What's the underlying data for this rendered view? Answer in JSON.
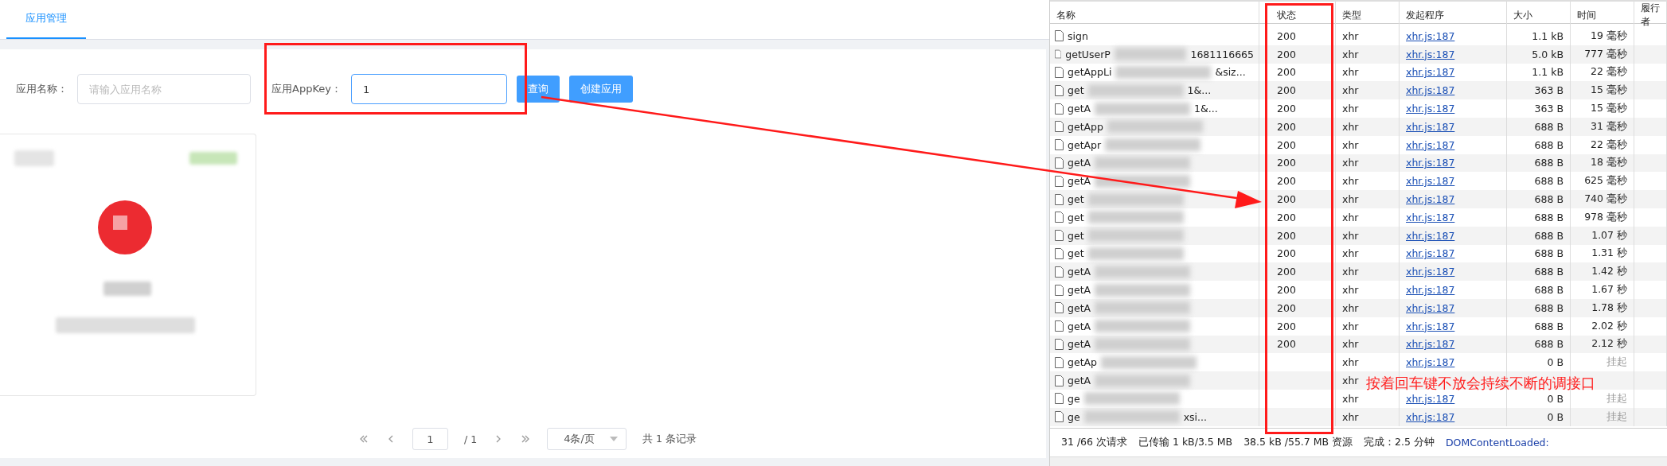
{
  "tabs": [
    {
      "label": "应用管理",
      "selected": true
    }
  ],
  "search_form": {
    "fields": [
      {
        "label": "应用名称：",
        "placeholder": "请输入应用名称"
      },
      {
        "label": "应用AppKey：",
        "value": "1"
      }
    ],
    "buttons": [
      "查询",
      "创建应用"
    ]
  },
  "pagination": {
    "page": "1",
    "total_pages": "/ 1",
    "page_size": "4条/页",
    "total": "共 1 条记录"
  },
  "network": {
    "columns": [
      "名称",
      "状态",
      "类型",
      "发起程序",
      "大小",
      "时间",
      "履行者"
    ],
    "rows": [
      {
        "name": "sign",
        "status": "200",
        "type": "xhr",
        "initiator": "xhr.js:187",
        "size": "1.1 kB",
        "time": "19 毫秒",
        "pending": false
      },
      {
        "name": "getUserP",
        "name_end": "1681116665",
        "status": "200",
        "type": "xhr",
        "initiator": "xhr.js:187",
        "size": "5.0 kB",
        "time": "777 毫秒",
        "pending": false
      },
      {
        "name": "getAppLi",
        "name_end": "&siz...",
        "status": "200",
        "type": "xhr",
        "initiator": "xhr.js:187",
        "size": "1.1 kB",
        "time": "22 毫秒",
        "pending": false
      },
      {
        "name": "get",
        "name_end": "1&...",
        "status": "200",
        "type": "xhr",
        "initiator": "xhr.js:187",
        "size": "363 B",
        "time": "15 毫秒",
        "pending": false
      },
      {
        "name": "getA",
        "name_end": "1&...",
        "status": "200",
        "type": "xhr",
        "initiator": "xhr.js:187",
        "size": "363 B",
        "time": "15 毫秒",
        "pending": false
      },
      {
        "name": "getApp",
        "status": "200",
        "type": "xhr",
        "initiator": "xhr.js:187",
        "size": "688 B",
        "time": "31 毫秒",
        "pending": false
      },
      {
        "name": "getApr",
        "status": "200",
        "type": "xhr",
        "initiator": "xhr.js:187",
        "size": "688 B",
        "time": "22 毫秒",
        "pending": false
      },
      {
        "name": "getA",
        "status": "200",
        "type": "xhr",
        "initiator": "xhr.js:187",
        "size": "688 B",
        "time": "18 毫秒",
        "pending": false
      },
      {
        "name": "getA",
        "status": "200",
        "type": "xhr",
        "initiator": "xhr.js:187",
        "size": "688 B",
        "time": "625 毫秒",
        "pending": false
      },
      {
        "name": "get",
        "status": "200",
        "type": "xhr",
        "initiator": "xhr.js:187",
        "size": "688 B",
        "time": "740 毫秒",
        "pending": false
      },
      {
        "name": "get",
        "status": "200",
        "type": "xhr",
        "initiator": "xhr.js:187",
        "size": "688 B",
        "time": "978 毫秒",
        "pending": false
      },
      {
        "name": "get",
        "status": "200",
        "type": "xhr",
        "initiator": "xhr.js:187",
        "size": "688 B",
        "time": "1.07 秒",
        "pending": false
      },
      {
        "name": "get",
        "status": "200",
        "type": "xhr",
        "initiator": "xhr.js:187",
        "size": "688 B",
        "time": "1.31 秒",
        "pending": false
      },
      {
        "name": "getA",
        "status": "200",
        "type": "xhr",
        "initiator": "xhr.js:187",
        "size": "688 B",
        "time": "1.42 秒",
        "pending": false
      },
      {
        "name": "getA",
        "status": "200",
        "type": "xhr",
        "initiator": "xhr.js:187",
        "size": "688 B",
        "time": "1.67 秒",
        "pending": false
      },
      {
        "name": "getA",
        "status": "200",
        "type": "xhr",
        "initiator": "xhr.js:187",
        "size": "688 B",
        "time": "1.78 秒",
        "pending": false
      },
      {
        "name": "getA",
        "status": "200",
        "type": "xhr",
        "initiator": "xhr.js:187",
        "size": "688 B",
        "time": "2.02 秒",
        "pending": false
      },
      {
        "name": "getA",
        "status": "200",
        "type": "xhr",
        "initiator": "xhr.js:187",
        "size": "688 B",
        "time": "2.12 秒",
        "pending": false
      },
      {
        "name": "getAp",
        "type": "xhr",
        "initiator": "xhr.js:187",
        "size": "0 B",
        "time": "挂起",
        "pending": true
      },
      {
        "name": "getA",
        "type": "xhr"
      },
      {
        "name": "ge",
        "type": "xhr",
        "initiator": "xhr.js:187",
        "size": "0 B",
        "time": "挂起",
        "pending": true
      },
      {
        "name": "ge",
        "name_end": "xsi...",
        "type": "xhr",
        "initiator": "xhr.js:187",
        "size": "0 B",
        "time": "挂起",
        "pending": true
      }
    ],
    "status_bar": [
      {
        "kind": "plain",
        "text": "31 /66 次请求"
      },
      {
        "kind": "plain",
        "text": "已传输 1 kB/3.5 MB"
      },
      {
        "kind": "plain",
        "text": "38.5 kB /55.7 MB 资源"
      },
      {
        "kind": "plain",
        "text": "完成：2.5 分钟"
      },
      {
        "kind": "link",
        "text": "DOMContentLoaded:"
      }
    ]
  },
  "annotation": {
    "text": "按着回车键不放会持续不断的调接口"
  }
}
